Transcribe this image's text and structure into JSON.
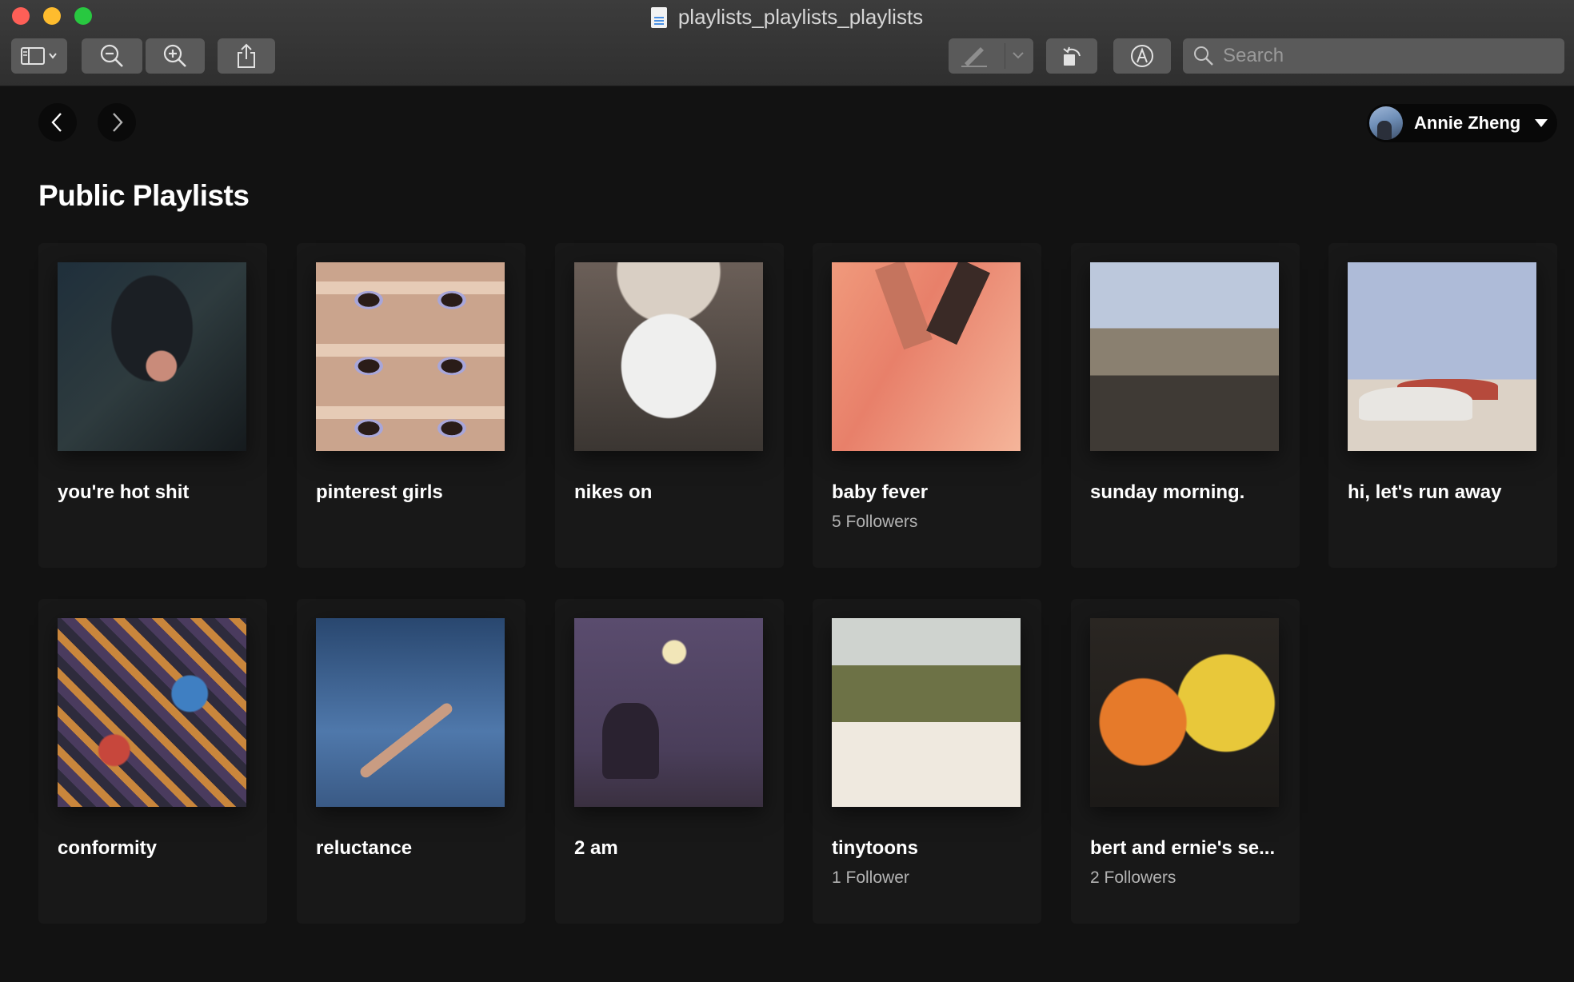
{
  "window": {
    "title": "playlists_playlists_playlists"
  },
  "toolbar": {
    "search_placeholder": "Search",
    "buttons": [
      "sidebar-toggle",
      "zoom-out",
      "zoom-in",
      "share",
      "markup",
      "rotate",
      "annotate"
    ]
  },
  "header": {
    "user_name": "Annie Zheng"
  },
  "main": {
    "section_title": "Public Playlists",
    "playlists": [
      {
        "name": "you're hot shit",
        "subtitle": ""
      },
      {
        "name": "pinterest girls",
        "subtitle": ""
      },
      {
        "name": "nikes on",
        "subtitle": ""
      },
      {
        "name": "baby fever",
        "subtitle": "5 Followers"
      },
      {
        "name": "sunday morning.",
        "subtitle": ""
      },
      {
        "name": "hi, let's run away",
        "subtitle": ""
      },
      {
        "name": "conformity",
        "subtitle": ""
      },
      {
        "name": "reluctance",
        "subtitle": ""
      },
      {
        "name": "2 am",
        "subtitle": ""
      },
      {
        "name": "tinytoons",
        "subtitle": "1 Follower"
      },
      {
        "name": "bert and ernie's se...",
        "subtitle": "2 Followers"
      }
    ]
  },
  "colors": {
    "background": "#121212",
    "card": "#181818",
    "subtext": "#b3b3b3",
    "toolbar": "#3c3c3c"
  }
}
